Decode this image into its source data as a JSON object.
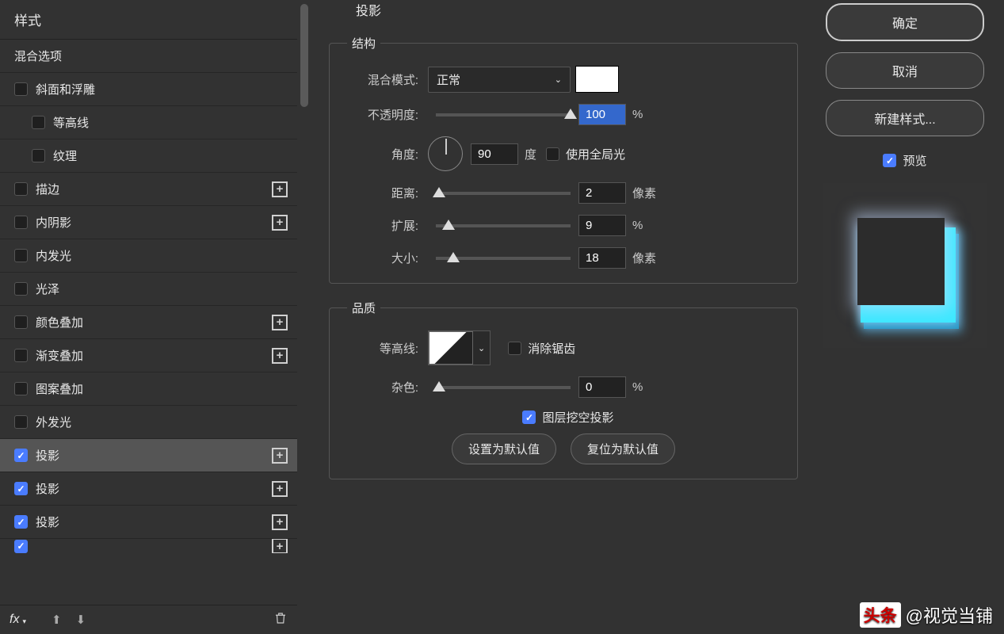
{
  "sidebar": {
    "header": "样式",
    "blending_options": "混合选项",
    "items": [
      {
        "label": "斜面和浮雕",
        "checked": false,
        "add": false,
        "sub": false
      },
      {
        "label": "等高线",
        "checked": false,
        "add": false,
        "sub": true
      },
      {
        "label": "纹理",
        "checked": false,
        "add": false,
        "sub": true
      },
      {
        "label": "描边",
        "checked": false,
        "add": true,
        "sub": false
      },
      {
        "label": "内阴影",
        "checked": false,
        "add": true,
        "sub": false
      },
      {
        "label": "内发光",
        "checked": false,
        "add": false,
        "sub": false
      },
      {
        "label": "光泽",
        "checked": false,
        "add": false,
        "sub": false
      },
      {
        "label": "颜色叠加",
        "checked": false,
        "add": true,
        "sub": false
      },
      {
        "label": "渐变叠加",
        "checked": false,
        "add": true,
        "sub": false
      },
      {
        "label": "图案叠加",
        "checked": false,
        "add": false,
        "sub": false
      },
      {
        "label": "外发光",
        "checked": false,
        "add": false,
        "sub": false
      },
      {
        "label": "投影",
        "checked": true,
        "add": true,
        "sub": false,
        "active": true
      },
      {
        "label": "投影",
        "checked": true,
        "add": true,
        "sub": false
      },
      {
        "label": "投影",
        "checked": true,
        "add": true,
        "sub": false
      }
    ],
    "footer": {
      "fx": "fx"
    }
  },
  "main": {
    "title": "投影",
    "structure": {
      "legend": "结构",
      "blend_mode_label": "混合模式:",
      "blend_mode_value": "正常",
      "opacity_label": "不透明度:",
      "opacity_value": "100",
      "opacity_unit": "%",
      "angle_label": "角度:",
      "angle_value": "90",
      "angle_unit": "度",
      "global_light_label": "使用全局光",
      "distance_label": "距离:",
      "distance_value": "2",
      "distance_unit": "像素",
      "spread_label": "扩展:",
      "spread_value": "9",
      "spread_unit": "%",
      "size_label": "大小:",
      "size_value": "18",
      "size_unit": "像素"
    },
    "quality": {
      "legend": "品质",
      "contour_label": "等高线:",
      "antialias_label": "消除锯齿",
      "noise_label": "杂色:",
      "noise_value": "0",
      "noise_unit": "%",
      "knockout_label": "图层挖空投影"
    },
    "buttons": {
      "set_default": "设置为默认值",
      "reset_default": "复位为默认值"
    }
  },
  "right": {
    "ok": "确定",
    "cancel": "取消",
    "new_style": "新建样式...",
    "preview_label": "预览"
  },
  "watermark": {
    "logo": "头条",
    "text": "@视觉当铺"
  }
}
